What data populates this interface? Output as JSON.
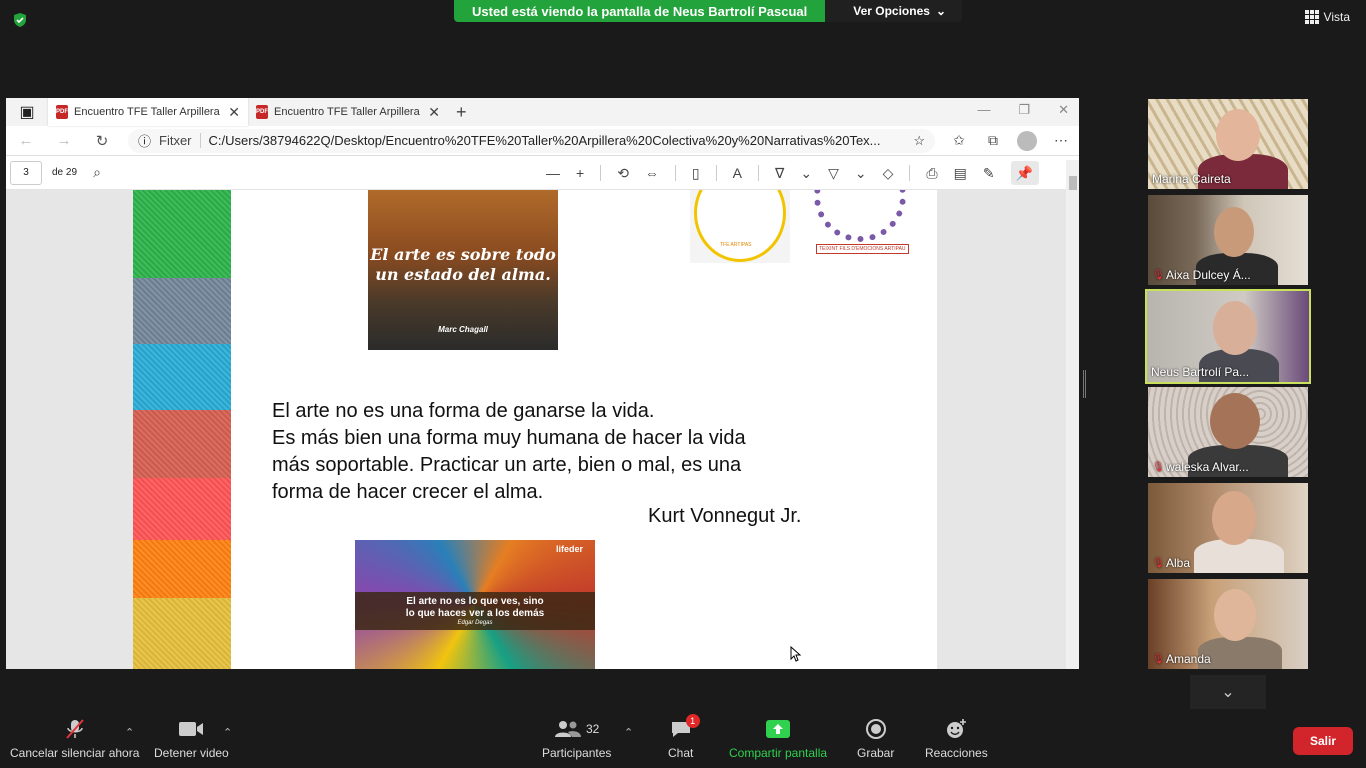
{
  "banner": {
    "viewing_text": "Usted está viendo la pantalla de Neus Bartrolí Pascual",
    "options_label": "Ver Opciones",
    "view_label": "Vista"
  },
  "browser": {
    "tabs": [
      {
        "title": "Encuentro TFE Taller Arpillera Co"
      },
      {
        "title": "Encuentro TFE Taller Arpillera Co"
      }
    ],
    "address": {
      "label": "Fitxer",
      "url": "C:/Users/38794622Q/Desktop/Encuentro%20TFE%20Taller%20Arpillera%20Colectiva%20y%20Narrativas%20Tex..."
    },
    "pdf": {
      "page_current": "3",
      "page_total": "de 29"
    }
  },
  "document": {
    "art1_quote": "El arte es sobre todo un estado del alma.",
    "art1_author": "Marc Chagall",
    "logo1_text": "TFE ARTIPAS",
    "logo2_text": "TEIXINT FILS D'EMOCIONS ARTIPAU",
    "quote_lines": [
      "El arte no es una forma de ganarse la vida.",
      "Es más bien una forma muy humana de hacer la vida",
      "más soportable. Practicar un arte, bien o mal, es una",
      "forma de hacer crecer el alma."
    ],
    "quote_author": "Kurt Vonnegut Jr.",
    "art2_brand": "lifeder",
    "art2_quote_1": "El arte no es lo que ves, sino",
    "art2_quote_2": "lo que haces ver a los demás",
    "art2_author": "Edgar Degas"
  },
  "participants": [
    {
      "name": "Marina Caireta",
      "muted": false
    },
    {
      "name": "Aixa Dulcey Á...",
      "muted": true
    },
    {
      "name": "Neus Bartrolí Pa...",
      "muted": false,
      "active": true
    },
    {
      "name": "waleska Alvar...",
      "muted": true
    },
    {
      "name": "Alba",
      "muted": true
    },
    {
      "name": "Amanda",
      "muted": true
    }
  ],
  "toolbar": {
    "mute_label": "Cancelar silenciar ahora",
    "video_label": "Detener video",
    "participants_label": "Participantes",
    "participants_count": "32",
    "chat_label": "Chat",
    "chat_badge": "1",
    "share_label": "Compartir pantalla",
    "record_label": "Grabar",
    "reactions_label": "Reacciones",
    "leave_label": "Salir"
  },
  "colors": {
    "banner_green": "#23a33b",
    "leave_red": "#d1252b",
    "active_speaker": "#c9e05a",
    "share_green": "#2fd14f"
  }
}
